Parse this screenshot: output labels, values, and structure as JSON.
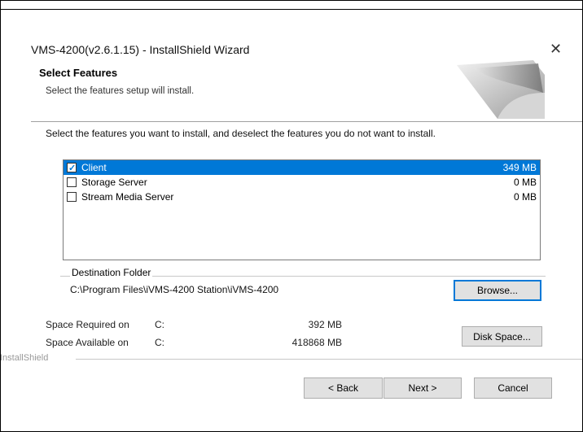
{
  "window": {
    "title": "VMS-4200(v2.6.1.15) - InstallShield Wizard",
    "close_glyph": "✕"
  },
  "header": {
    "title": "Select Features",
    "subtitle": "Select the features setup will install."
  },
  "instructions": "Select the features you want to install, and deselect the features you do not want to install.",
  "features": [
    {
      "name": "Client",
      "size": "349 MB",
      "checked": true,
      "selected": true
    },
    {
      "name": "Storage Server",
      "size": "0 MB",
      "checked": false,
      "selected": false
    },
    {
      "name": "Stream Media Server",
      "size": "0 MB",
      "checked": false,
      "selected": false
    }
  ],
  "destination": {
    "label": "Destination Folder",
    "path": "C:\\Program Files\\iVMS-4200 Station\\iVMS-4200",
    "browse_label": "Browse..."
  },
  "space": {
    "required_label": "Space Required on",
    "required_drive": "C:",
    "required_value": "392 MB",
    "available_label": "Space Available on",
    "available_drive": "C:",
    "available_value": "418868 MB",
    "disk_space_label": "Disk Space..."
  },
  "footer": {
    "brand": "InstallShield",
    "back_label": "< Back",
    "next_label": "Next >",
    "cancel_label": "Cancel"
  },
  "colors": {
    "selection": "#0078d7",
    "button_face": "#e1e1e1"
  }
}
